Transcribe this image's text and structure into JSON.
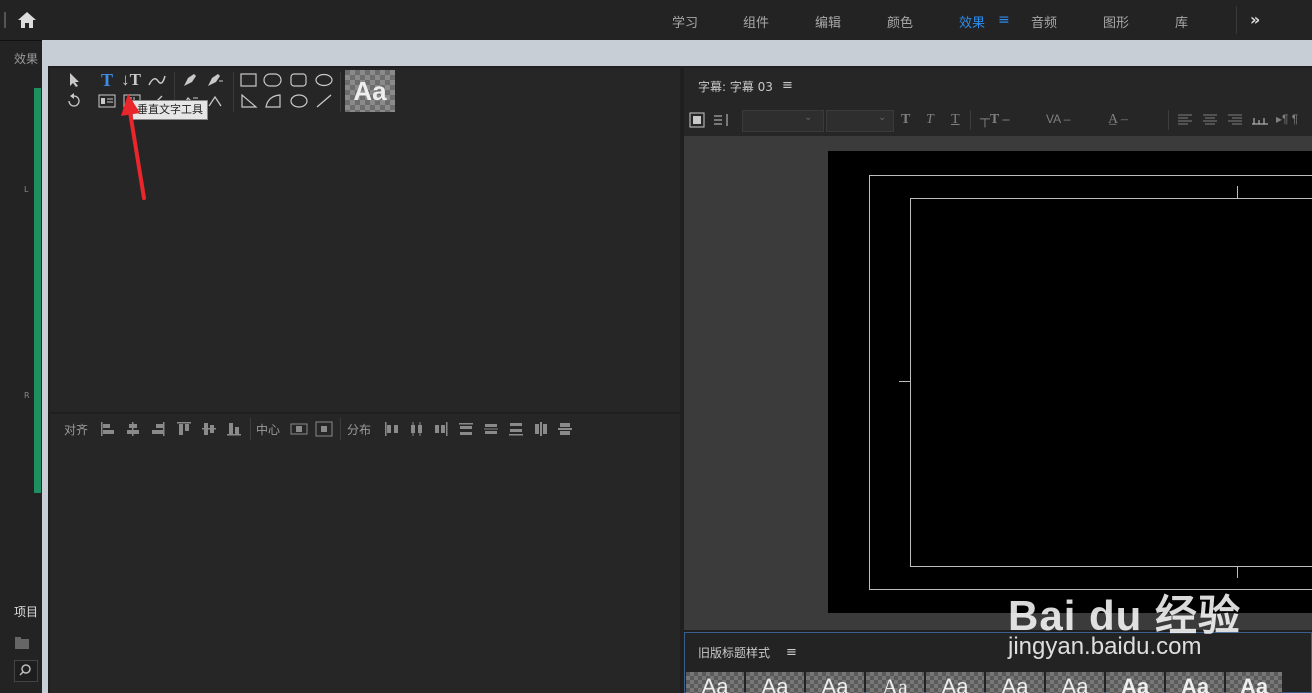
{
  "top_nav": {
    "items": [
      "学习",
      "组件",
      "编辑",
      "颜色",
      "效果",
      "音频",
      "图形",
      "库"
    ],
    "active": "效果",
    "overflow": "»"
  },
  "left_panel": {
    "effects_tab": "效果",
    "channel_l": "L",
    "channel_r": "R",
    "project_tab": "项目"
  },
  "tools": {
    "tooltip": "垂直文字工具",
    "style_preview": "Aa"
  },
  "align": {
    "align_label": "对齐",
    "center_label": "中心",
    "distribute_label": "分布"
  },
  "designer": {
    "title": "字幕: 字幕 03"
  },
  "styles_panel": {
    "title": "旧版标题样式",
    "swatches": [
      "Aa",
      "Aa",
      "Aa",
      "Aa",
      "Aa",
      "Aa",
      "Aa",
      "Aa",
      "Aa",
      "Aa"
    ]
  },
  "watermark": {
    "logo": "Bai du 经验",
    "url": "jingyan.baidu.com"
  },
  "colors": {
    "accent": "#2d8ceb",
    "meter": "#1d8f60",
    "annotation_arrow": "#e8262b"
  }
}
